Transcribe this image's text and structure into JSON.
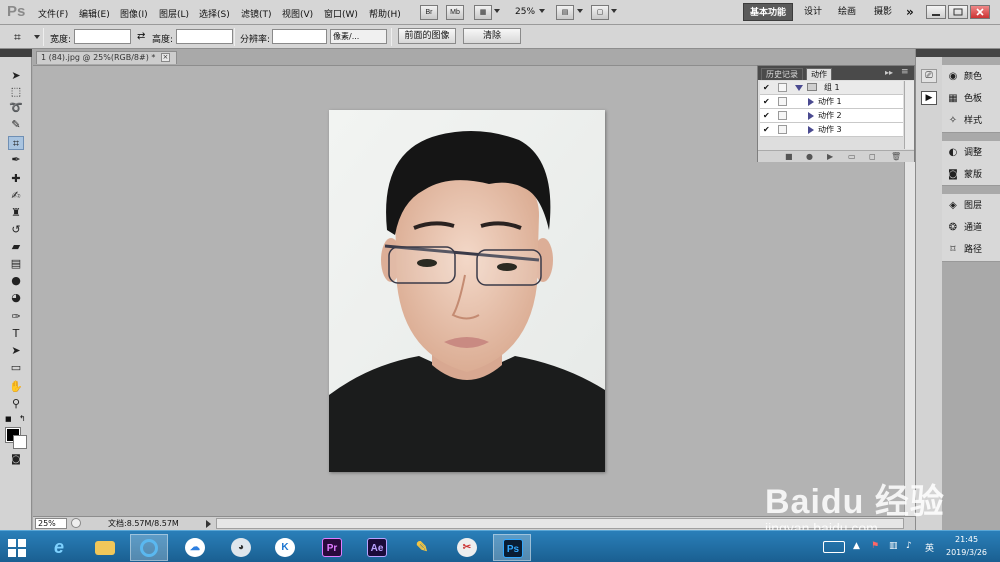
{
  "menubar": {
    "app_logo": "Ps",
    "items": [
      "文件(F)",
      "编辑(E)",
      "图像(I)",
      "图层(L)",
      "选择(S)",
      "滤镜(T)",
      "视图(V)",
      "窗口(W)",
      "帮助(H)"
    ],
    "bridge_label": "Br",
    "mini_bridge_label": "Mb",
    "zoom": "25%",
    "workspaces": [
      "基本功能",
      "设计",
      "绘画",
      "摄影"
    ],
    "more_label": "»"
  },
  "options": {
    "width_label": "宽度:",
    "width_value": "",
    "height_label": "高度:",
    "height_value": "",
    "resolution_label": "分辨率:",
    "resolution_value": "",
    "unit_value": "像素/...",
    "front_image_label": "前面的图像",
    "clear_label": "清除"
  },
  "document": {
    "tab_title": "1 (84).jpg @ 25%(RGB/8#) *",
    "tab_close": "×",
    "status_zoom": "25%",
    "doc_size": "文档:8.57M/8.57M"
  },
  "actions_panel": {
    "tabs": [
      "历史记录",
      "动作"
    ],
    "active_tab": "动作",
    "rows": [
      {
        "label": "组 1",
        "checked": true,
        "type": "folder"
      },
      {
        "label": "动作 1",
        "checked": true,
        "type": "action"
      },
      {
        "label": "动作 2",
        "checked": true,
        "type": "action"
      },
      {
        "label": "动作 3",
        "checked": true,
        "type": "action"
      }
    ]
  },
  "dock": {
    "items": [
      "颜色",
      "色板",
      "样式",
      "调整",
      "蒙版",
      "图层",
      "通道",
      "路径"
    ],
    "icons": [
      "color-icon",
      "swatches-icon",
      "styles-icon",
      "adjustments-icon",
      "masks-icon",
      "layers-icon",
      "channels-icon",
      "paths-icon"
    ]
  },
  "taskbar": {
    "apps": [
      "Internet Explorer",
      "File Explorer",
      "Browser",
      "Baidu Netdisk",
      "Cat App",
      "K App",
      "Premiere Pro",
      "After Effects",
      "Paint App",
      "Screenshot Tool",
      "Photoshop"
    ],
    "active_app": "Photoshop",
    "ime": "英",
    "time": "21:45",
    "date": "2019/3/26"
  },
  "watermark": {
    "brand": "Baidu 经验",
    "url": "jingyan.baidu.com"
  },
  "colors": {
    "foreground": "#000000",
    "background": "#ffffff",
    "taskbar": "#2a7fb9",
    "workspace_active": "#5a5a5a"
  }
}
